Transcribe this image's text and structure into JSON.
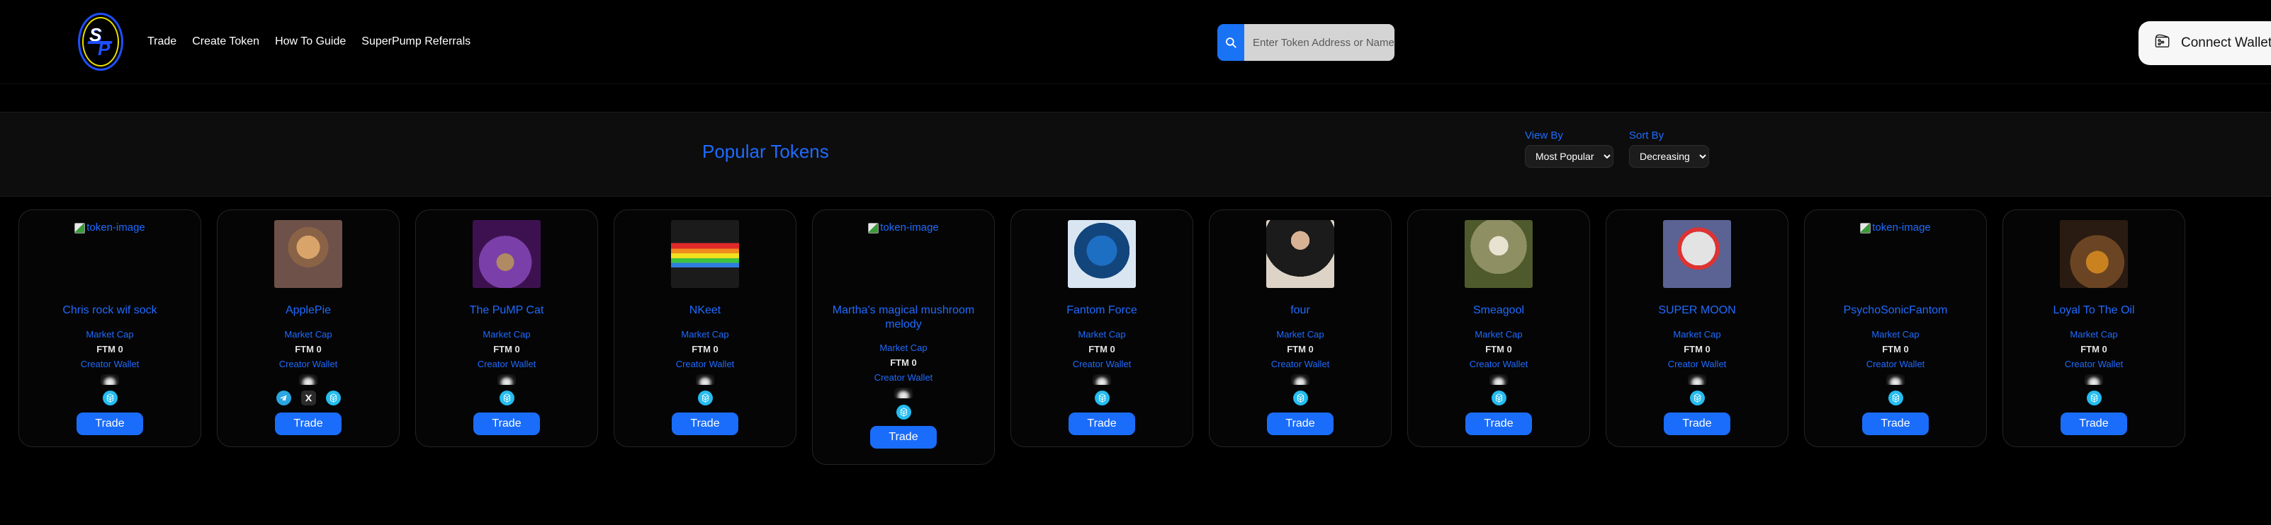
{
  "header": {
    "logo_letters": {
      "s": "S",
      "p": "P"
    },
    "nav": [
      {
        "label": "Trade",
        "name": "nav-trade"
      },
      {
        "label": "Create Token",
        "name": "nav-create-token"
      },
      {
        "label": "How To Guide",
        "name": "nav-how-to-guide"
      },
      {
        "label": "SuperPump Referrals",
        "name": "nav-superpump-referrals"
      }
    ],
    "search": {
      "placeholder": "Enter Token Address or Name",
      "value": ""
    },
    "connect_wallet_label": "Connect Wallet"
  },
  "panel": {
    "title": "Popular Tokens",
    "view_by": {
      "label": "View By",
      "selected": "Most Popular",
      "options": [
        "Most Popular"
      ]
    },
    "sort_by": {
      "label": "Sort By",
      "selected": "Decreasing",
      "options": [
        "Decreasing"
      ]
    }
  },
  "card_labels": {
    "market_cap": "Market Cap",
    "creator_wallet": "Creator Wallet",
    "trade": "Trade",
    "broken_image_alt": "token-image"
  },
  "colors": {
    "accent_blue": "#1f6bff",
    "trade_blue": "#1a6dfb",
    "page_bg": "#000000",
    "card_bg": "#050505",
    "search_accent": "#1a73f5"
  },
  "tokens": [
    {
      "name": "Chris rock wif sock",
      "market_cap": "FTM 0",
      "image_broken": true,
      "image_kind": "broken",
      "socials": [
        "ftm-icon"
      ]
    },
    {
      "name": "ApplePie",
      "market_cap": "FTM 0",
      "image_broken": false,
      "image_kind": "apple-pie",
      "socials": [
        "telegram-icon",
        "x-icon",
        "ftm-icon"
      ]
    },
    {
      "name": "The PuMP Cat",
      "market_cap": "FTM 0",
      "image_broken": false,
      "image_kind": "pump-cat",
      "socials": [
        "ftm-icon"
      ]
    },
    {
      "name": "NKeet",
      "market_cap": "FTM 0",
      "image_broken": false,
      "image_kind": "nyan-cat",
      "socials": [
        "ftm-icon"
      ]
    },
    {
      "name": "Martha's magical mushroom melody",
      "market_cap": "FTM 0",
      "image_broken": true,
      "image_kind": "broken",
      "socials": [
        "ftm-icon"
      ]
    },
    {
      "name": "Fantom Force",
      "market_cap": "FTM 0",
      "image_broken": false,
      "image_kind": "fantom-force",
      "socials": [
        "ftm-icon"
      ]
    },
    {
      "name": "four",
      "market_cap": "FTM 0",
      "image_broken": false,
      "image_kind": "person",
      "socials": [
        "ftm-icon"
      ]
    },
    {
      "name": "Smeagool",
      "market_cap": "FTM 0",
      "image_broken": false,
      "image_kind": "smeagool",
      "socials": [
        "ftm-icon"
      ]
    },
    {
      "name": "SUPER MOON",
      "market_cap": "FTM 0",
      "image_broken": false,
      "image_kind": "super-moon",
      "socials": [
        "ftm-icon"
      ]
    },
    {
      "name": "PsychoSonicFantom",
      "market_cap": "FTM 0",
      "image_broken": true,
      "image_kind": "broken",
      "socials": [
        "ftm-icon"
      ]
    },
    {
      "name": "Loyal To The Oil",
      "market_cap": "FTM 0",
      "image_broken": false,
      "image_kind": "oil",
      "socials": [
        "ftm-icon"
      ]
    }
  ]
}
